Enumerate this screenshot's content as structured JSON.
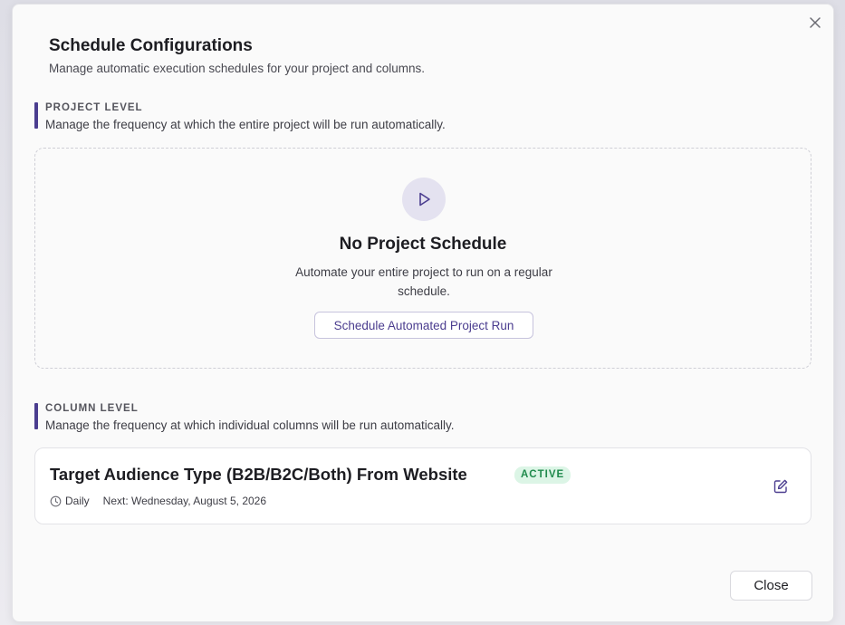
{
  "dialog": {
    "title": "Schedule Configurations",
    "subtitle": "Manage automatic execution schedules for your project and columns.",
    "close_icon": "close-icon"
  },
  "project_level": {
    "label": "PROJECT LEVEL",
    "description": "Manage the frequency at which the entire project will be run automatically.",
    "empty_state": {
      "icon": "play-icon",
      "title": "No Project Schedule",
      "description": "Automate your entire project to run on a regular schedule.",
      "button_label": "Schedule Automated Project Run"
    }
  },
  "column_level": {
    "label": "COLUMN LEVEL",
    "description": "Manage the frequency at which individual columns will be run automatically.",
    "schedules": [
      {
        "name": "Target Audience Type (B2B/B2C/Both) From Website",
        "status": "ACTIVE",
        "frequency": "Daily",
        "next_run": "Next: Wednesday, August 5, 2026",
        "edit_icon": "edit-icon"
      }
    ]
  },
  "footer": {
    "close_label": "Close"
  },
  "colors": {
    "accent": "#4b3d8f",
    "active_badge_bg": "#dcf5e6",
    "active_badge_text": "#1f8a4c"
  }
}
